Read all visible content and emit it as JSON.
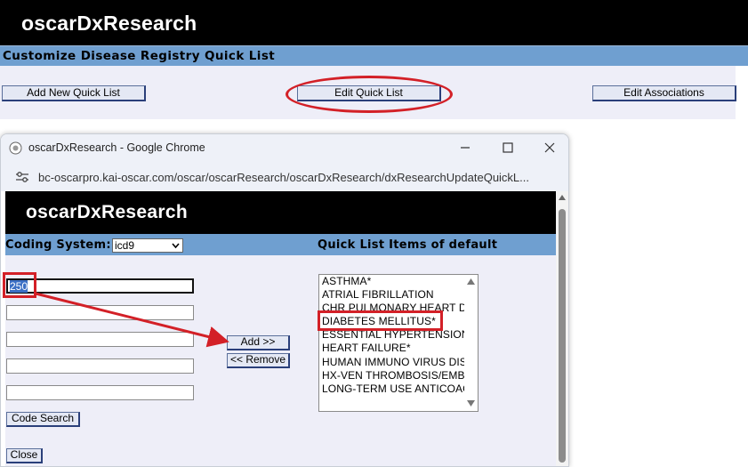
{
  "background": {
    "app_title": "oscarDxResearch",
    "page_subtitle": "Customize Disease Registry Quick List",
    "buttons": {
      "add_new": "Add New Quick List",
      "edit_quick": "Edit Quick List",
      "edit_assoc": "Edit Associations"
    }
  },
  "popup": {
    "window_title": "oscarDxResearch - Google Chrome",
    "url": "bc-oscarpro.kai-oscar.com/oscar/oscarResearch/oscarDxResearch/dxResearchUpdateQuickL...",
    "app_title": "oscarDxResearch",
    "coding_system_label": "Coding System:",
    "coding_system_value": "icd9",
    "quick_list_label": "Quick List Items of default",
    "code_inputs": [
      "250",
      "",
      "",
      "",
      ""
    ],
    "add_button": "Add >>",
    "remove_button": "<< Remove",
    "code_search_button": "Code Search",
    "close_button": "Close",
    "quick_list_items": [
      "ASTHMA*",
      "ATRIAL FIBRILLATION",
      "CHR PULMONARY HEART D",
      "DIABETES MELLITUS*",
      "ESSENTIAL HYPERTENSION",
      "HEART FAILURE*",
      "HUMAN IMMUNO VIRUS DIS",
      "HX-VEN THROMBOSIS/EMBO",
      "LONG-TERM USE ANTICOAG"
    ]
  },
  "colors": {
    "header_bg": "#000000",
    "subbar_bg": "#6f9fd0",
    "body_bg": "#eeeef8",
    "annotation_red": "#d32027"
  },
  "icons": [
    "site-info-icon",
    "minimize-icon",
    "maximize-icon",
    "close-icon",
    "scroll-up-icon",
    "scroll-down-icon",
    "dropdown-arrow-icon"
  ]
}
